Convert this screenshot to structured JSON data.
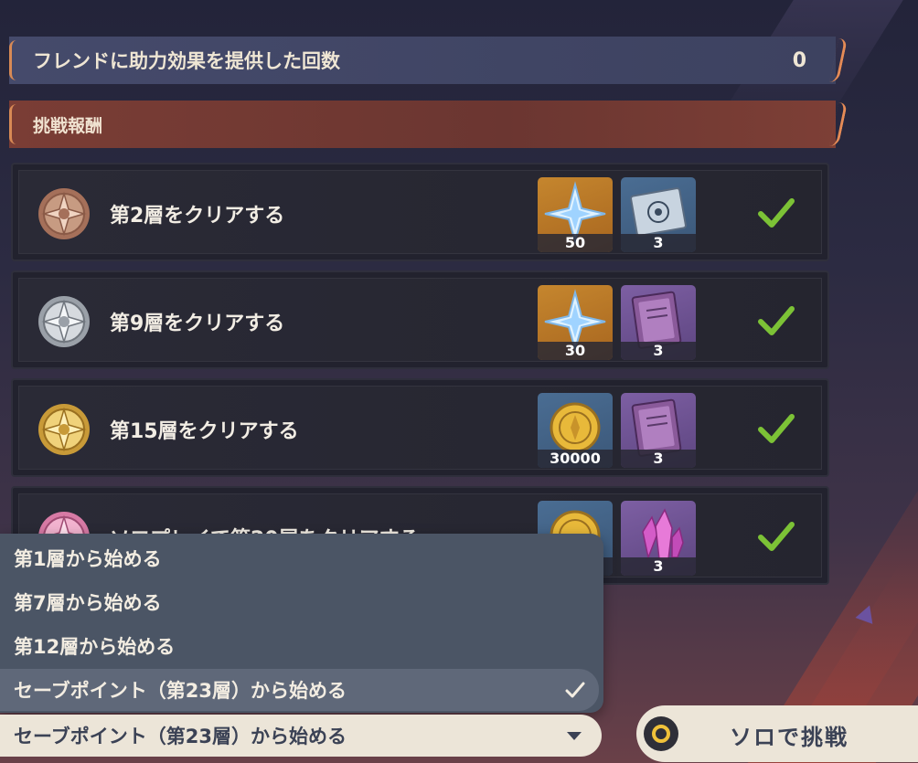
{
  "friend_support": {
    "label": "フレンドに助力効果を提供した回数",
    "value": "0"
  },
  "rewards_section": {
    "title": "挑戦報酬"
  },
  "rows": [
    {
      "label": "第2層をクリアする",
      "medal": "bronze-medal-icon",
      "rewards": [
        {
          "icon": "primogem-icon",
          "count": "50"
        },
        {
          "icon": "blueprint-scroll-icon",
          "count": "3"
        }
      ],
      "completed": true
    },
    {
      "label": "第9層をクリアする",
      "medal": "silver-medal-icon",
      "rewards": [
        {
          "icon": "primogem-icon",
          "count": "30"
        },
        {
          "icon": "purple-book-icon",
          "count": "3"
        }
      ],
      "completed": true
    },
    {
      "label": "第15層をクリアする",
      "medal": "gold-medal-icon",
      "rewards": [
        {
          "icon": "mora-coin-icon",
          "count": "30000"
        },
        {
          "icon": "purple-book-icon",
          "count": "3"
        }
      ],
      "completed": true
    },
    {
      "label": "ソロプレイで第20層をクリアする",
      "medal": "pink-medal-icon",
      "rewards": [
        {
          "icon": "mora-coin-icon",
          "count": ""
        },
        {
          "icon": "purple-crystal-icon",
          "count": "3"
        }
      ],
      "completed": true
    }
  ],
  "start_options": [
    {
      "label": "第1層から始める",
      "selected": false
    },
    {
      "label": "第7層から始める",
      "selected": false
    },
    {
      "label": "第12層から始める",
      "selected": false
    },
    {
      "label": "セーブポイント（第23層）から始める",
      "selected": true
    }
  ],
  "start_select": {
    "value": "セーブポイント（第23層）から始める"
  },
  "solo_button": {
    "label": "ソロで挑戦",
    "icon": "controller-circle-icon"
  },
  "colors": {
    "accent": "#e58b56",
    "check": "#7cc236",
    "button_bg": "#ece5d8",
    "dropdown_bg": "#4b5565"
  }
}
